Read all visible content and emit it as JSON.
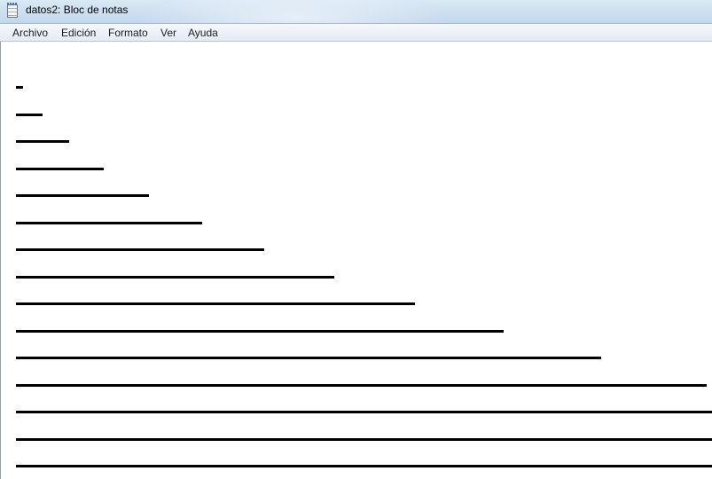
{
  "window": {
    "title": "datos2: Bloc de notas",
    "icon": "notepad-icon"
  },
  "menu": {
    "items": [
      {
        "label": "Archivo"
      },
      {
        "label": "Edición"
      },
      {
        "label": "Formato"
      },
      {
        "label": "Ver"
      },
      {
        "label": "Ayuda"
      }
    ]
  },
  "editor": {
    "lines": [
      "_",
      "___",
      "_____",
      "__________",
      "_______________",
      "_____________________",
      "____________________________",
      "____________________________________",
      "_____________________________________________",
      "_______________________________________________________",
      "__________________________________________________________________",
      "________________________________________________________________________________",
      "_____________________________________________________________________________________",
      "_____________________________________________________________________________________",
      "_____________________________________________________________________________________"
    ]
  }
}
